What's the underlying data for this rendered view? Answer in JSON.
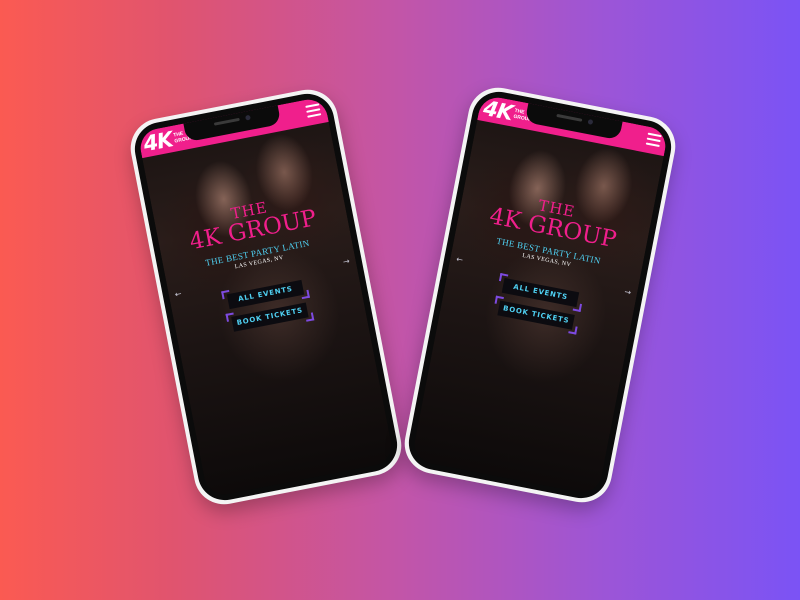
{
  "site": {
    "logo_main": "4K",
    "logo_small": [
      "THE",
      "GROUP"
    ],
    "title_the": "THE",
    "title_main": "4K GROUP",
    "subtitle": "THE BEST PARTY LATIN",
    "location": "LAS VEGAS, NV",
    "buttons": {
      "events": "ALL EVENTS",
      "tickets": "BOOK TICKETS"
    },
    "arrows": {
      "prev": "←",
      "next": "→"
    },
    "icons": {
      "menu": "hamburger-menu-icon",
      "prev": "arrow-left-icon",
      "next": "arrow-right-icon"
    }
  },
  "colors": {
    "accent_pink": "#f01f8c",
    "accent_cyan": "#4fd0f2",
    "accent_purple": "#7d4ae0",
    "bg_gradient_left": "#fb5a52",
    "bg_gradient_right": "#7b53f5"
  }
}
